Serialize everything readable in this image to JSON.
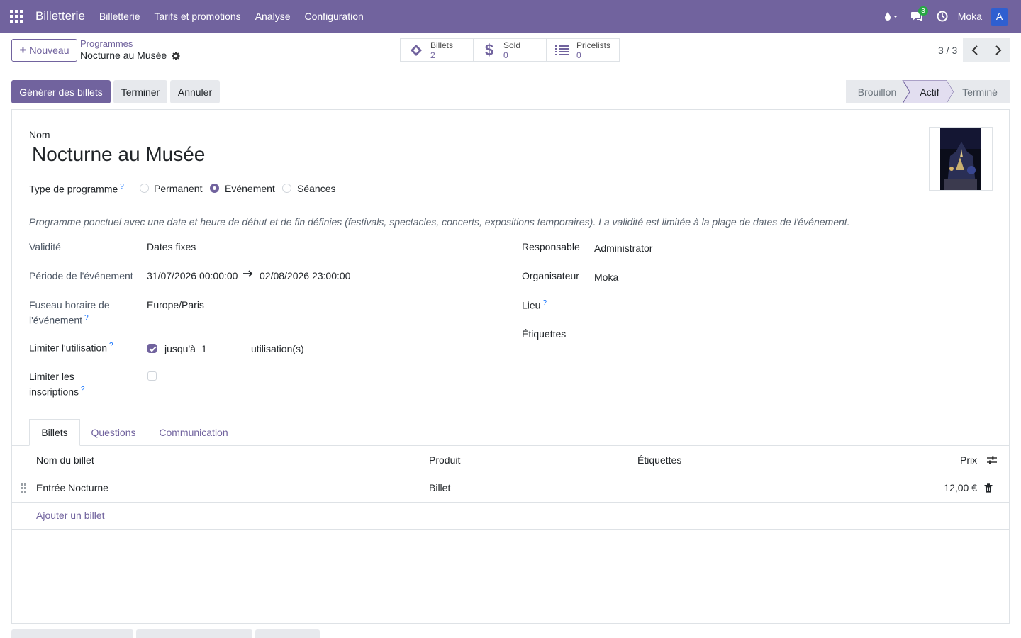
{
  "nav": {
    "app_name": "Billetterie",
    "menu": [
      "Billetterie",
      "Tarifs et promotions",
      "Analyse",
      "Configuration"
    ],
    "messages_count": "3",
    "company": "Moka",
    "avatar_letter": "A"
  },
  "control_panel": {
    "new_button": "Nouveau",
    "breadcrumb_parent": "Programmes",
    "breadcrumb_current": "Nocturne au Musée",
    "smart_buttons": [
      {
        "label": "Billets",
        "value": "2",
        "icon": "ticket-icon"
      },
      {
        "label": "Sold",
        "value": "0",
        "icon": "dollar-icon"
      },
      {
        "label": "Pricelists",
        "value": "0",
        "icon": "list-icon"
      }
    ],
    "pager": "3 / 3"
  },
  "statusbar": {
    "buttons": [
      "Générer des billets",
      "Terminer",
      "Annuler"
    ],
    "stages": [
      "Brouillon",
      "Actif",
      "Terminé"
    ],
    "active_stage": "Actif"
  },
  "form": {
    "name_label": "Nom",
    "name_value": "Nocturne au Musée",
    "program_type_label": "Type de programme",
    "program_types": [
      "Permanent",
      "Événement",
      "Séances"
    ],
    "program_type_selected": "Événement",
    "description": "Programme ponctuel avec une date et heure de début et de fin définies (festivals, spectacles, concerts, expositions temporaires). La validité est limitée à la plage de dates de l'événement.",
    "validity_label": "Validité",
    "validity_value": "Dates fixes",
    "period_label": "Période de l'événement",
    "period_start": "31/07/2026 00:00:00",
    "period_end": "02/08/2026 23:00:00",
    "timezone_label_1": "Fuseau horaire de",
    "timezone_label_2": "l'événement",
    "timezone_value": "Europe/Paris",
    "limit_usage_label": "Limiter l'utilisation",
    "limit_usage_checked": true,
    "limit_usage_prefix": "jusqu'à",
    "limit_usage_value": "1",
    "limit_usage_suffix": "utilisation(s)",
    "limit_reg_label_1": "Limiter les",
    "limit_reg_label_2": "inscriptions",
    "limit_reg_checked": false,
    "responsible_label": "Responsable",
    "responsible_value": "Administrator",
    "organizer_label": "Organisateur",
    "organizer_value": "Moka",
    "location_label": "Lieu",
    "location_value": "",
    "tags_label": "Étiquettes",
    "tags_value": ""
  },
  "tabs": [
    "Billets",
    "Questions",
    "Communication"
  ],
  "active_tab": "Billets",
  "tickets_table": {
    "columns": [
      "Nom du billet",
      "Produit",
      "Étiquettes",
      "Prix"
    ],
    "rows": [
      {
        "name": "Entrée Nocturne",
        "product": "Billet",
        "tags": "",
        "price": "12,00 €"
      }
    ],
    "add_line": "Ajouter un billet"
  },
  "colors": {
    "brand": "#71639e",
    "nav_bg": "#71639e",
    "badge": "#28a745",
    "avatar": "#2f5fd0"
  }
}
